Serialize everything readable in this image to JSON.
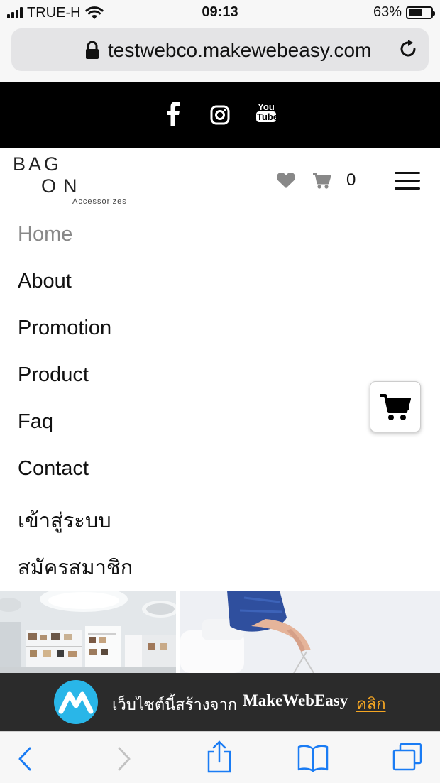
{
  "status_bar": {
    "carrier": "TRUE-H",
    "time": "09:13",
    "battery": "63%",
    "battery_level": 0.63
  },
  "browser": {
    "url": "testwebco.makewebeasy.com"
  },
  "social": {
    "icons": [
      "facebook-icon",
      "instagram-icon",
      "youtube-icon"
    ],
    "youtube_top": "You",
    "youtube_bottom": "Tube"
  },
  "header": {
    "logo_line1": "BAG",
    "logo_line2": "ON",
    "logo_sub": "Accessorizes",
    "cart_count": "0"
  },
  "menu": {
    "items": [
      {
        "label": "Home",
        "active": true
      },
      {
        "label": "About"
      },
      {
        "label": "Promotion"
      },
      {
        "label": "Product"
      },
      {
        "label": "Faq"
      },
      {
        "label": "Contact"
      },
      {
        "label": "เข้าสู่ระบบ"
      },
      {
        "label": "สมัครสมาชิก"
      }
    ]
  },
  "footer_strip": {
    "text": "เว็บไซต์นี้สร้างจาก",
    "brand": "MakeWebEasy",
    "link": "คลิก"
  },
  "colors": {
    "social_bar": "#000000",
    "menu_active": "#888888",
    "mwe_logo": "#29b6e8",
    "mwe_link": "#f5a623",
    "ios_blue": "#1a7cf4"
  }
}
